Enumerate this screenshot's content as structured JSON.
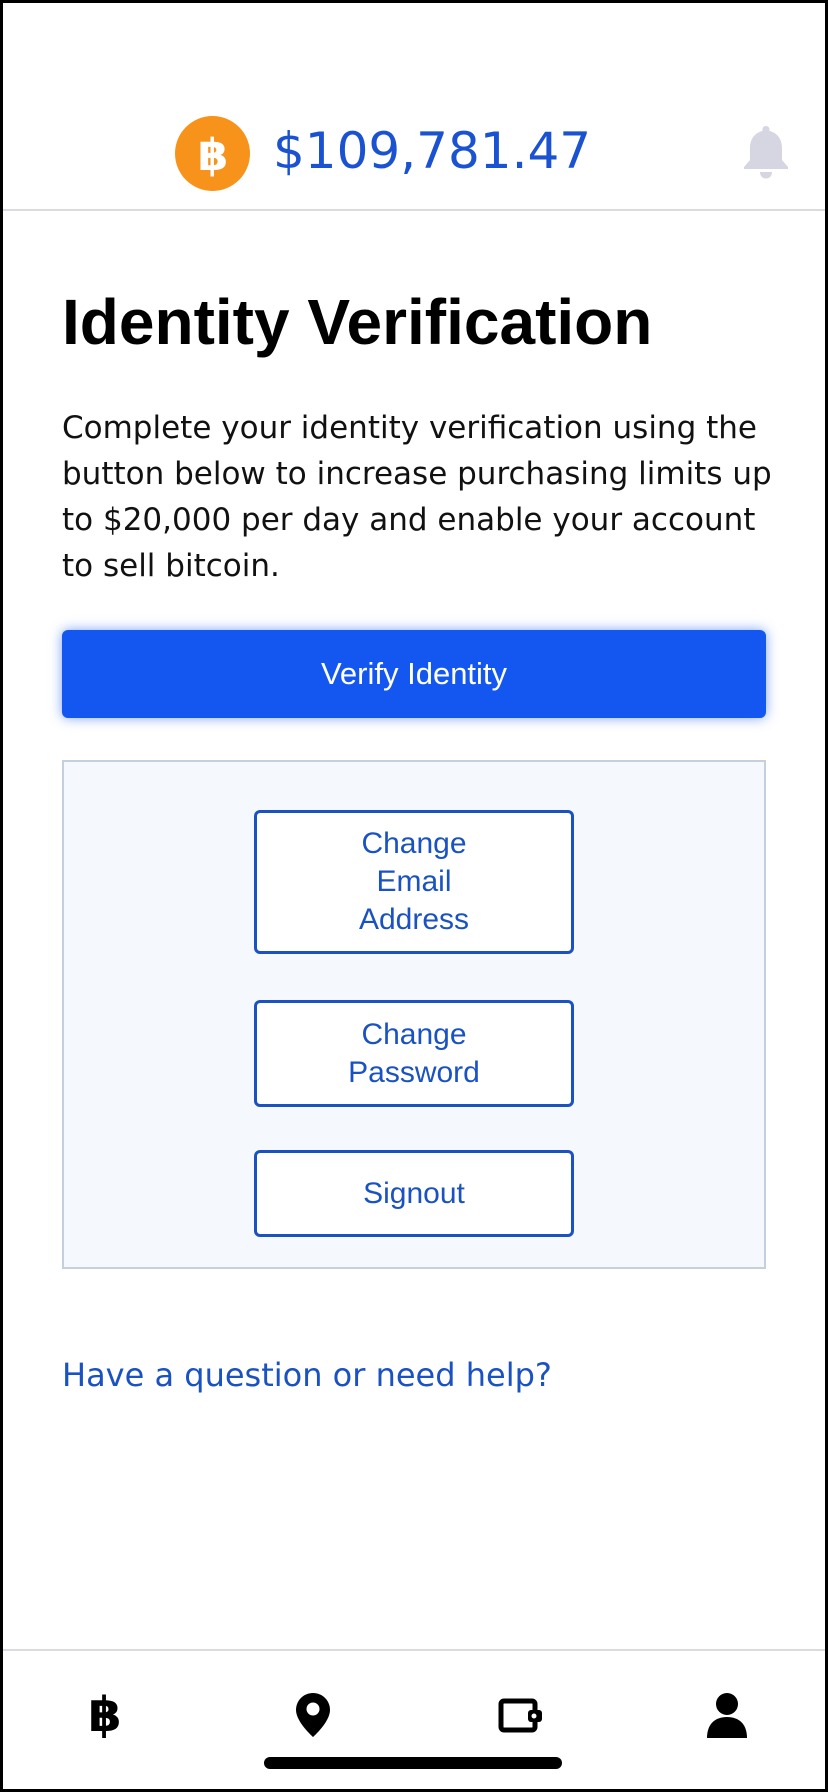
{
  "header": {
    "price": "$109,781.47",
    "logo_glyph": "฿",
    "logo_icon": "bitcoin-logo-icon",
    "bell_icon": "bell-icon",
    "accent_color": "#1a52d1",
    "logo_color": "#f7931a"
  },
  "main": {
    "title": "Identity Verification",
    "description": "Complete your identity verification using the button below to increase purchasing limits up to $20,000 per day and enable your account to sell bitcoin.",
    "verify_button": "Verify Identity",
    "verify_color": "#1457f0"
  },
  "account_panel": {
    "change_email": "Change\nEmail\nAddress",
    "change_password": "Change\nPassword",
    "signout": "Signout"
  },
  "help_link": "Have a question or need help?",
  "bottom_nav": {
    "items": [
      {
        "icon": "bitcoin-icon",
        "glyph": "฿"
      },
      {
        "icon": "map-pin-icon"
      },
      {
        "icon": "wallet-icon"
      },
      {
        "icon": "user-icon"
      }
    ]
  }
}
